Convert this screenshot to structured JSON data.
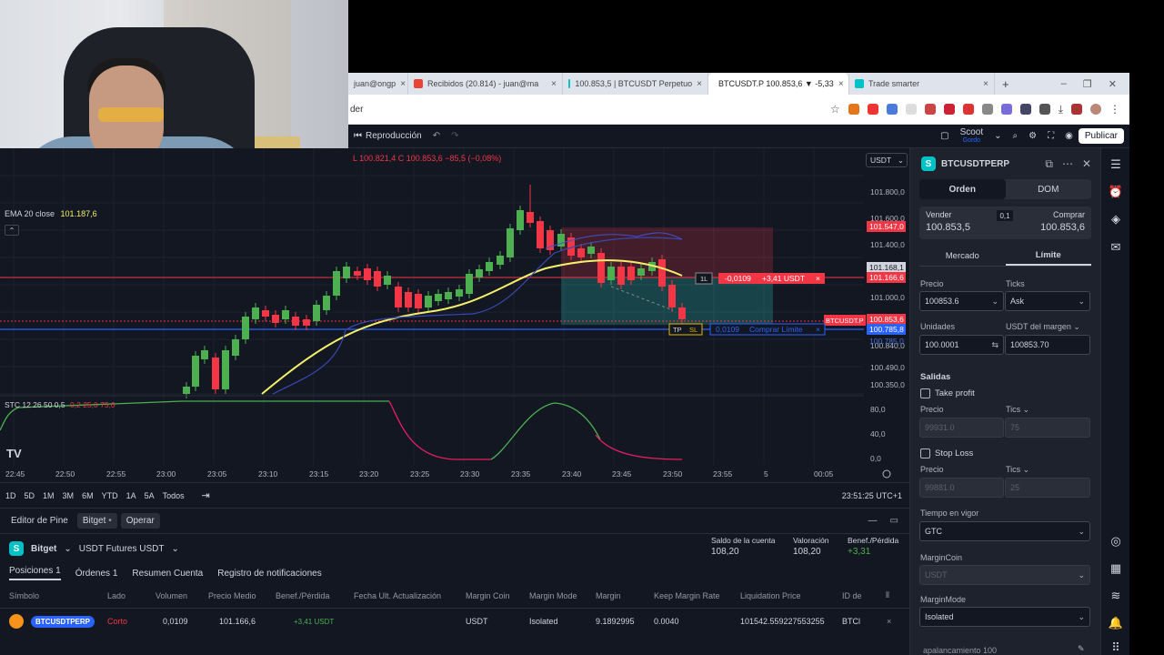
{
  "browser": {
    "tabs": [
      {
        "label": "juan@ongp",
        "color": "#ffffff"
      },
      {
        "label": "Recibidos (20.814) - juan@ma",
        "color": "#ea4335"
      },
      {
        "label": "100.853,5 | BTCUSDT Perpetuo",
        "color": "#00c2c7"
      },
      {
        "label": "BTCUSDT.P 100.853,6 ▼ -5,33",
        "color": "#131722"
      },
      {
        "label": "Trade smarter",
        "color": "#00c2c7"
      }
    ],
    "new_tab": "+",
    "url": "der"
  },
  "toolbar": {
    "replay": "Reproducción",
    "profile_name": "Scoot",
    "profile_sub": "Gordo",
    "publish": "Publicar"
  },
  "chart": {
    "ohlc": "L 100.821,4  C 100.853,6  −85,5 (−0,08%)",
    "currency": "USDT",
    "ema_label": "EMA 20 close",
    "ema_value": "101.187,6",
    "stc_label": "STC 12 26 50 0,5",
    "stc_values": "0,2  25,0  75,0",
    "position_qty": "0,0109",
    "position_pnl": "+3,41 USDT",
    "order_qty": "0,0109",
    "order_label": "Comprar Límite",
    "tp": "TP",
    "sl": "SL",
    "last_label": "BTCUSDT.P",
    "price_axis": [
      "101.800,0",
      "101.600,0",
      "101.400,0",
      "101.200,0",
      "101.000,0",
      "100.840,0",
      "100.490,0",
      "100.350,0"
    ],
    "badges": {
      "sl": "101.547,0",
      "pos1": "101.168,1",
      "pos2": "101.166,6",
      "last": "100.853,6",
      "order": "100.785,8",
      "low": "100.785,0"
    },
    "stc_axis": [
      "80,0",
      "40,0",
      "0,0"
    ],
    "time_axis": [
      "22:45",
      "22:50",
      "22:55",
      "23:00",
      "23:05",
      "23:10",
      "23:15",
      "23:20",
      "23:25",
      "23:30",
      "23:35",
      "23:40",
      "23:45",
      "23:50",
      "23:55",
      "5",
      "00:05"
    ],
    "colors": {
      "up": "#4caf50",
      "down": "#f23645",
      "ema": "#f5f06b",
      "blue": "#2962ff"
    }
  },
  "timeframes": [
    "1D",
    "5D",
    "1M",
    "3M",
    "6M",
    "YTD",
    "1A",
    "5A",
    "Todos"
  ],
  "clock": "23:51:25 UTC+1",
  "bottom": {
    "tabs": [
      "Editor de Pine",
      "Bitget",
      "Operar"
    ],
    "broker": "Bitget",
    "account": "USDT Futures USDT",
    "stats": [
      {
        "label": "Saldo de la cuenta",
        "value": "108,20"
      },
      {
        "label": "Valoración",
        "value": "108,20"
      },
      {
        "label": "Benef./Pérdida",
        "value": "+3,31"
      }
    ],
    "pos_tabs": [
      "Posiciones 1",
      "Órdenes 1",
      "Resumen Cuenta",
      "Registro de notificaciones"
    ],
    "headers": [
      "Símbolo",
      "Lado",
      "Volumen",
      "Precio Medio",
      "Benef./Pérdida",
      "Fecha Ult. Actualización",
      "Margin Coin",
      "Margin Mode",
      "Margin",
      "Keep Margin Rate",
      "Liquidation Price",
      "ID de"
    ],
    "row": {
      "symbol": "BTCUSDTPERP",
      "side": "Corto",
      "volume": "0,0109",
      "avg_price": "101.166,6",
      "pnl": "+3,41 USDT",
      "margin_coin": "USDT",
      "margin_mode": "Isolated",
      "margin": "9.1892995",
      "keep_rate": "0.0040",
      "liq_price": "101542.559227553255",
      "id": "BTCl"
    }
  },
  "order_panel": {
    "symbol": "BTCUSDTPERP",
    "tab_order": "Orden",
    "tab_dom": "DOM",
    "sell_label": "Vender",
    "sell_price": "100.853,5",
    "spread": "0,1",
    "buy_label": "Comprar",
    "buy_price": "100.853,6",
    "market": "Mercado",
    "limit": "Límite",
    "price_label": "Precio",
    "ticks_label": "Ticks",
    "price_value": "100853.6",
    "ticks_value": "Ask",
    "units_label": "Unidades",
    "margin_label": "USDT del margen",
    "units_value": "100.0001",
    "margin_value": "100853.70",
    "exits": "Salidas",
    "take_profit": "Take profit",
    "tp_price_label": "Precio",
    "tp_ticks_label": "Tics",
    "tp_price": "99931.0",
    "tp_ticks": "75",
    "stop_loss": "Stop Loss",
    "sl_price_label": "Precio",
    "sl_ticks_label": "Tics",
    "sl_price": "99881.0",
    "sl_ticks": "25",
    "tif_label": "Tiempo en vigor",
    "tif_value": "GTC",
    "margincoin_label": "MarginCoin",
    "margincoin_value": "USDT",
    "marginmode_label": "MarginMode",
    "marginmode_value": "Isolated",
    "leverage_label": "apalancamiento 100"
  }
}
